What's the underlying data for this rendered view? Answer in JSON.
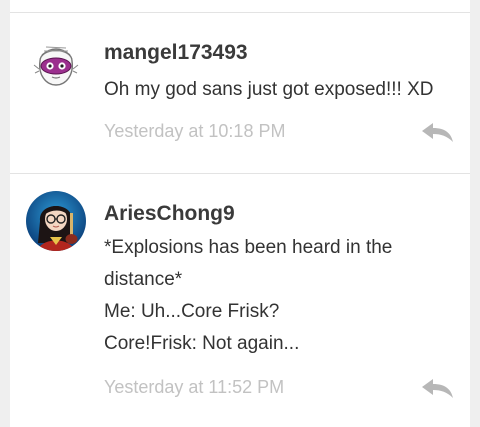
{
  "comments": [
    {
      "username": "mangel173493",
      "lines": [
        "Oh my god sans just got exposed!!! XD"
      ],
      "timestamp": "Yesterday at 10:18 PM",
      "avatar_icon": "masked-character-avatar",
      "reply_icon": "reply-arrow-icon"
    },
    {
      "username": "AriesChong9",
      "lines": [
        "*Explosions has been heard in the",
        "distance*",
        "Me: Uh...Core Frisk?",
        "Core!Frisk: Not again..."
      ],
      "timestamp": "Yesterday at 11:52 PM",
      "avatar_icon": "girl-with-glasses-avatar",
      "reply_icon": "reply-arrow-icon"
    }
  ],
  "colors": {
    "username": "#3a3a3a",
    "body": "#333333",
    "timestamp": "#c2c2c2",
    "reply_icon": "#b7b7b7",
    "divider": "#e3e3e3",
    "background": "#efefef"
  }
}
